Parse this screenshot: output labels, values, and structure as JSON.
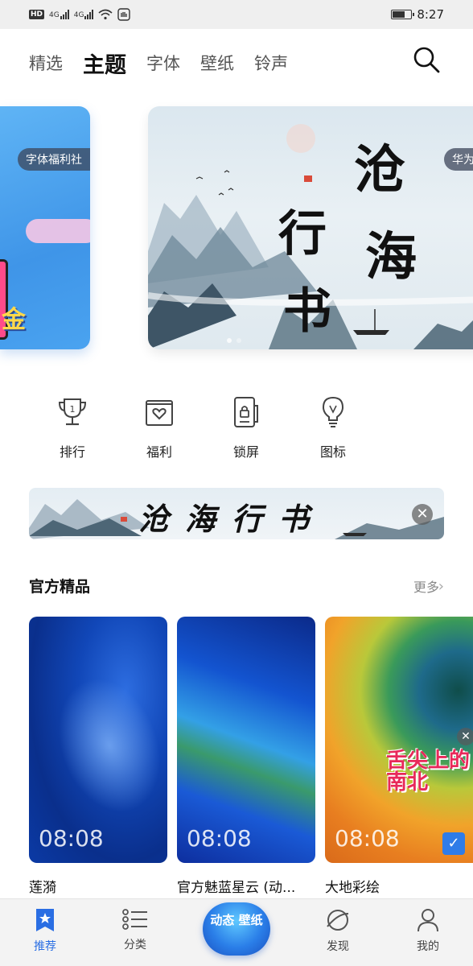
{
  "status_bar": {
    "time": "8:27",
    "hd": "HD",
    "net1": "4G",
    "net2": "4G"
  },
  "tabs": [
    "精选",
    "主题",
    "字体",
    "壁纸",
    "铃声"
  ],
  "active_tab": "主题",
  "banners": [
    {
      "tag": "字体福利社",
      "char": "金"
    },
    {
      "tag": "华为",
      "calligraphy": [
        "沧",
        "海",
        "行",
        "书"
      ]
    }
  ],
  "categories": [
    {
      "label": "排行",
      "icon": "trophy-icon"
    },
    {
      "label": "福利",
      "icon": "gift-heart-icon"
    },
    {
      "label": "锁屏",
      "icon": "lock-screen-icon"
    },
    {
      "label": "图标",
      "icon": "lightbulb-icon"
    }
  ],
  "ad_banner": {
    "text": "沧海行书"
  },
  "section": {
    "title": "官方精品",
    "more": "更多"
  },
  "themes": [
    {
      "name": "莲漪",
      "time": "08:08"
    },
    {
      "name": "官方魅蓝星云 (动...",
      "time": "08:08"
    },
    {
      "name": "大地彩绘",
      "time": "08:08",
      "sticker": "舌尖上的 南北"
    }
  ],
  "bottom_nav": [
    {
      "label": "推荐",
      "icon": "star-bookmark-icon",
      "active": true
    },
    {
      "label": "分类",
      "icon": "list-icon",
      "active": false
    },
    {
      "label": "动态 壁纸",
      "icon": "live-wallpaper-icon",
      "active": false
    },
    {
      "label": "发现",
      "icon": "planet-icon",
      "active": false
    },
    {
      "label": "我的",
      "icon": "person-icon",
      "active": false
    }
  ],
  "colors": {
    "accent": "#2a6ee3"
  }
}
